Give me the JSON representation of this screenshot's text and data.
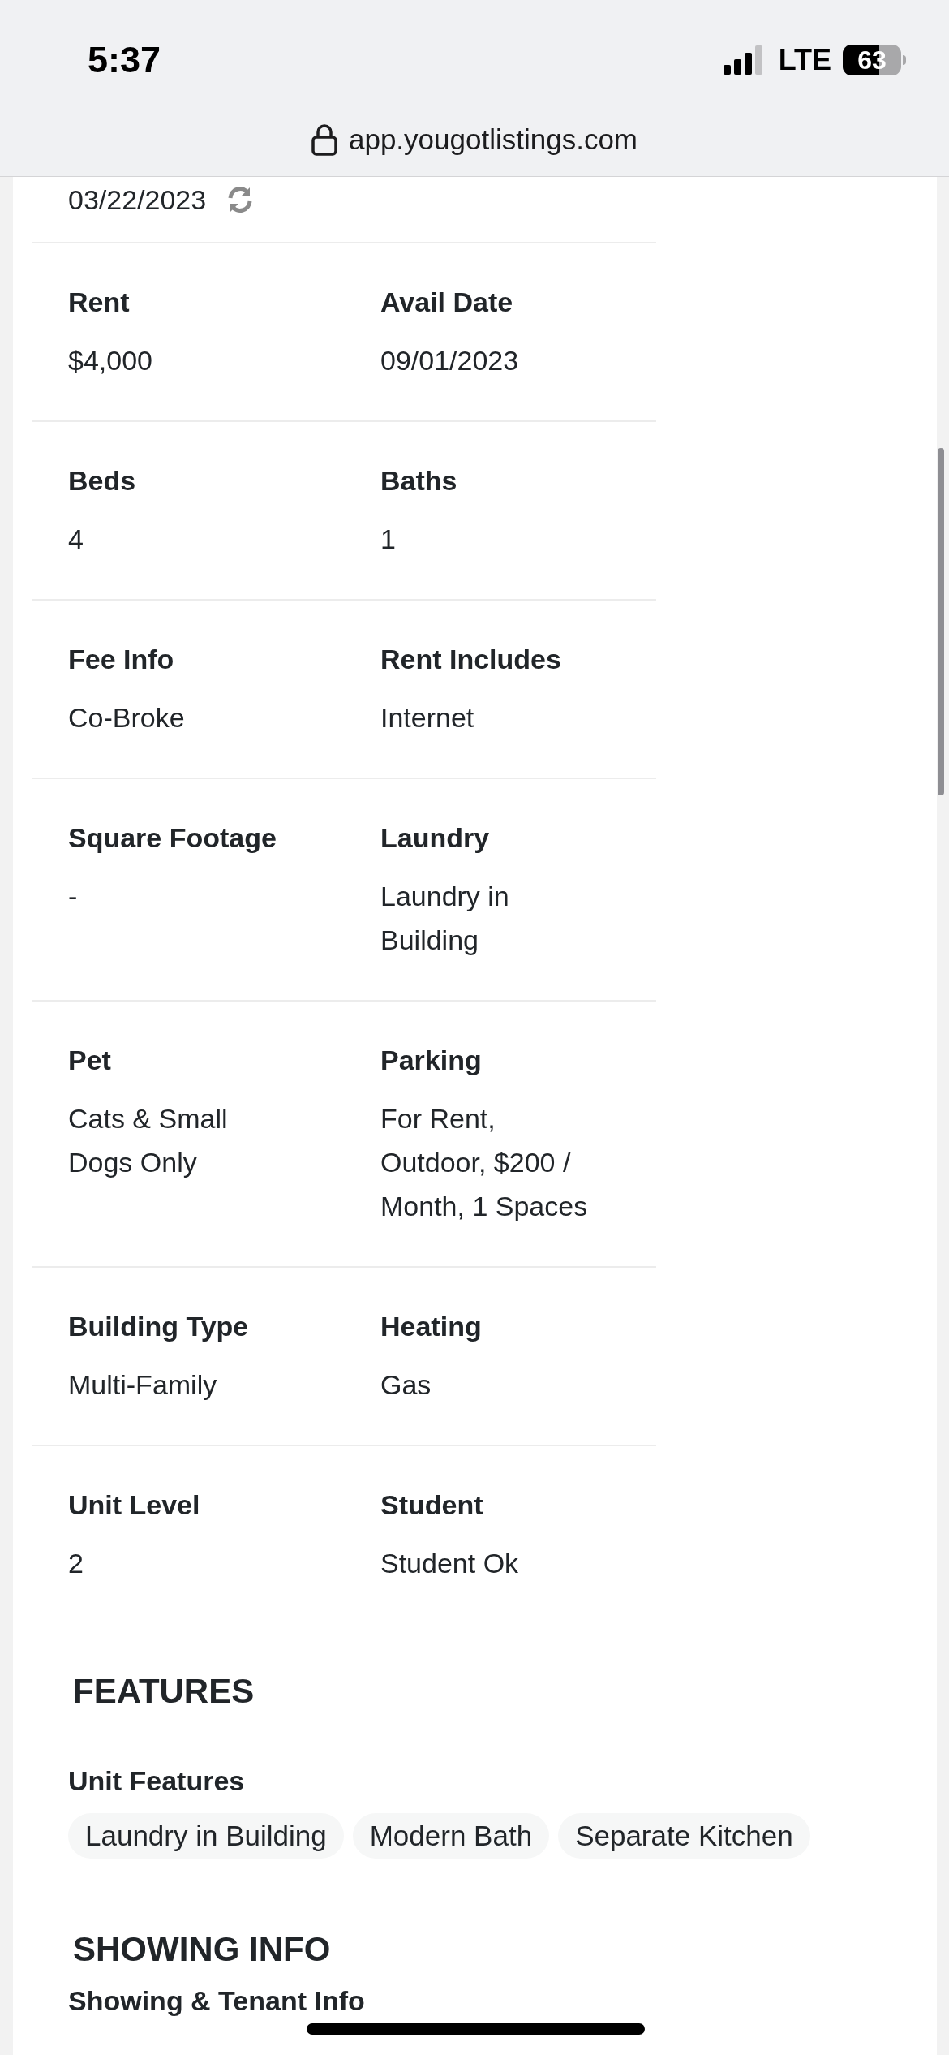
{
  "status_bar": {
    "time": "5:37",
    "network": "LTE",
    "battery": "63"
  },
  "address_bar": {
    "url": "app.yougotlistings.com"
  },
  "updated": {
    "date": "03/22/2023"
  },
  "rows": [
    {
      "left": {
        "label": "Rent",
        "value": "$4,000"
      },
      "right": {
        "label": "Avail Date",
        "value": "09/01/2023"
      }
    },
    {
      "left": {
        "label": "Beds",
        "value": "4"
      },
      "right": {
        "label": "Baths",
        "value": "1"
      }
    },
    {
      "left": {
        "label": "Fee Info",
        "value": "Co-Broke"
      },
      "right": {
        "label": "Rent Includes",
        "value": "Internet"
      }
    },
    {
      "left": {
        "label": "Square Footage",
        "value": "-"
      },
      "right": {
        "label": "Laundry",
        "value": "Laundry in Building"
      }
    },
    {
      "left": {
        "label": "Pet",
        "value": "Cats & Small Dogs Only"
      },
      "right": {
        "label": "Parking",
        "value": "For Rent, Outdoor, $200 / Month, 1 Spaces"
      }
    },
    {
      "left": {
        "label": "Building Type",
        "value": "Multi-Family"
      },
      "right": {
        "label": "Heating",
        "value": "Gas"
      }
    },
    {
      "left": {
        "label": "Unit Level",
        "value": "2"
      },
      "right": {
        "label": "Student",
        "value": "Student Ok"
      }
    }
  ],
  "features": {
    "title": "FEATURES",
    "groups": [
      {
        "label": "Unit Features",
        "tags": [
          "Laundry in Building",
          "Modern Bath",
          "Separate Kitchen"
        ]
      }
    ]
  },
  "showing": {
    "title": "SHOWING INFO",
    "subtitle": "Showing & Tenant Info"
  }
}
